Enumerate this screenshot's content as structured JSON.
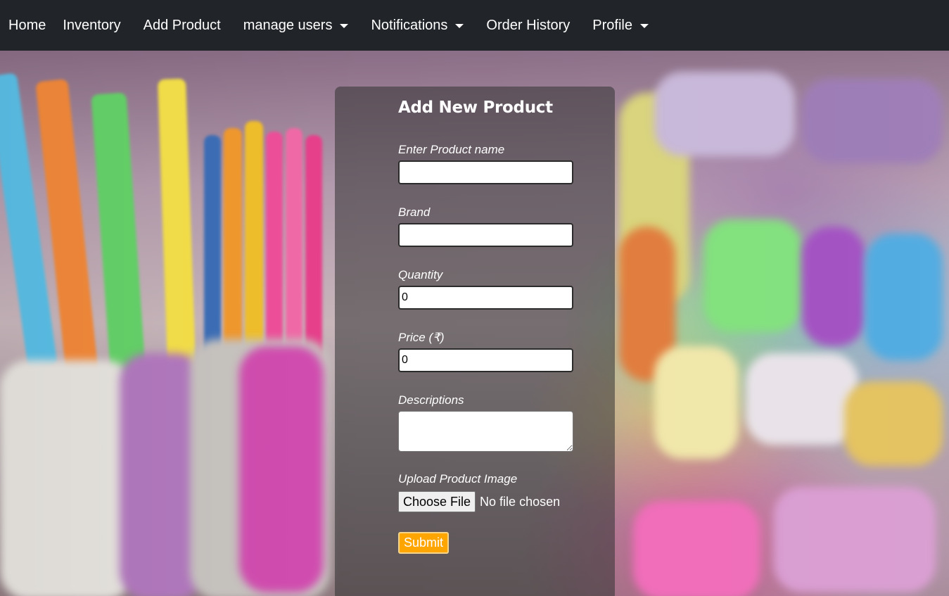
{
  "navbar": {
    "items": [
      {
        "label": "Home",
        "dropdown": false
      },
      {
        "label": "Inventory",
        "dropdown": false
      },
      {
        "label": "Add Product",
        "dropdown": false
      },
      {
        "label": "manage users",
        "dropdown": true
      },
      {
        "label": "Notifications",
        "dropdown": true
      },
      {
        "label": "Order History",
        "dropdown": false
      },
      {
        "label": "Profile",
        "dropdown": true
      }
    ]
  },
  "form": {
    "title": "Add New Product",
    "product_name": {
      "label": "Enter Product name",
      "value": ""
    },
    "brand": {
      "label": "Brand",
      "value": ""
    },
    "quantity": {
      "label": "Quantity",
      "value": "0"
    },
    "price": {
      "label": "Price (₹)",
      "value": "0"
    },
    "descriptions": {
      "label": "Descriptions",
      "value": ""
    },
    "image": {
      "label": "Upload Product Image",
      "button_label": "Choose File",
      "status": "No file chosen"
    },
    "submit_label": "Submit"
  },
  "colors": {
    "navbar_bg": "#212529",
    "submit_bg": "#ffa500"
  }
}
